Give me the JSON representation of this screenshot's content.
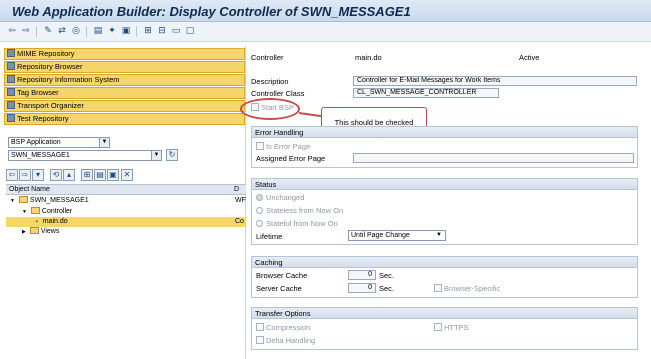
{
  "window": {
    "title": "Web Application Builder: Display Controller of SWN_MESSAGE1"
  },
  "toolbar": {
    "icons": [
      "back-icon",
      "forward-icon",
      "edit-icon",
      "switch-icon",
      "display-icon",
      "object-list-icon",
      "activate-icon",
      "test-icon",
      "where-used-icon",
      "hierarchy-icon",
      "layout-icon",
      "window-icon",
      "help-icon"
    ]
  },
  "nav": {
    "items": [
      "MIME Repository",
      "Repository Browser",
      "Repository Information System",
      "Tag Browser",
      "Transport Organizer",
      "Test Repository"
    ]
  },
  "browser": {
    "type_value": "BSP Application",
    "name_value": "SWN_MESSAGE1",
    "tree_header": "Object Name",
    "tree_header_col2": "D",
    "tree": [
      {
        "label": "SWN_MESSAGE1",
        "extra": "WF"
      },
      {
        "label": "Controller",
        "extra": ""
      },
      {
        "label": "main.do",
        "extra": "Co"
      },
      {
        "label": "Views",
        "extra": ""
      }
    ]
  },
  "controller": {
    "label": "Controller",
    "name": "main.do",
    "status": "Active",
    "description_label": "Description",
    "description_value": "Controller for E-Mail Messages for Work Items",
    "class_label": "Controller Class",
    "class_value": "CL_SWN_MESSAGE_CONTROLLER",
    "start_bsp_label": "Start BSP"
  },
  "callout": {
    "text": "This should be checked"
  },
  "error_handling": {
    "title": "Error Handling",
    "is_error_page_label": "Is Error Page",
    "assigned_error_page_label": "Assigned Error Page",
    "assigned_error_page_value": ""
  },
  "status": {
    "title": "Status",
    "options": [
      "Unchanged",
      "Stateless from Now On",
      "Stateful from Now On"
    ],
    "lifetime_label": "Lifetime",
    "lifetime_value": "Until Page Change"
  },
  "caching": {
    "title": "Caching",
    "browser_cache_label": "Browser Cache",
    "browser_cache_value": "0",
    "server_cache_label": "Server Cache",
    "server_cache_value": "0",
    "sec_label": "Sec.",
    "browser_specific_label": "Browser-Specific"
  },
  "transfer": {
    "title": "Transfer Options",
    "compression_label": "Compression",
    "https_label": "HTTPS",
    "delta_label": "Delta Handling"
  },
  "colors": {
    "nav_bg": "#f6d56a",
    "callout_border": "#c0504d",
    "title_text": "#0d2a52"
  }
}
